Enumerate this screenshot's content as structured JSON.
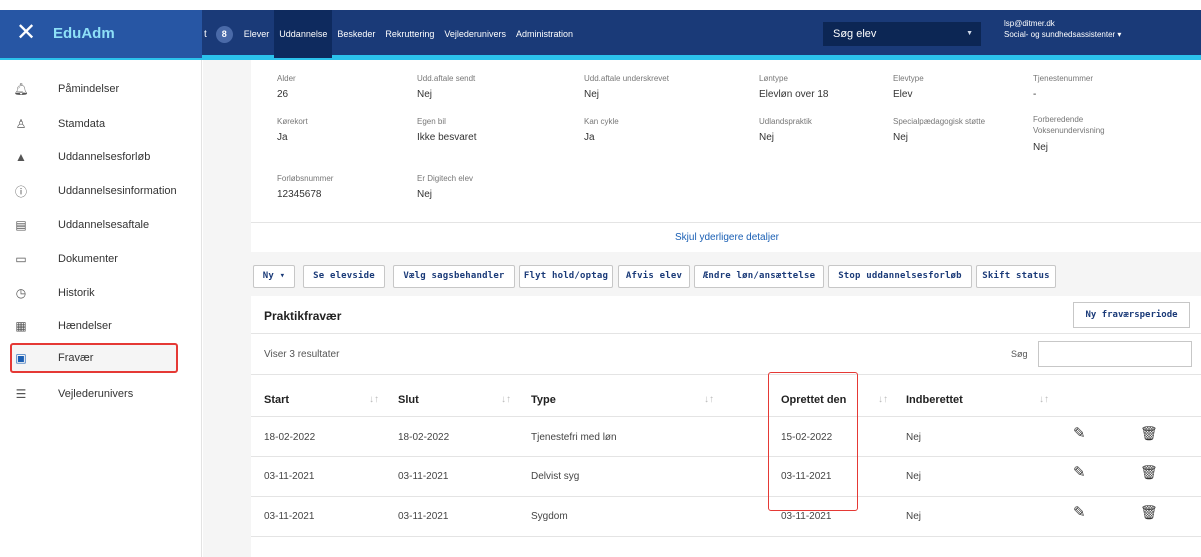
{
  "app": {
    "close_icon": "close-icon",
    "brand": "EduAdm"
  },
  "nav": {
    "cut_label": "t",
    "badge": "8",
    "items": [
      "Elever",
      "Uddannelse",
      "Beskeder",
      "Rekruttering",
      "Vejlederunivers",
      "Administration"
    ],
    "active": "Uddannelse"
  },
  "search": {
    "label": "Søg elev"
  },
  "user": {
    "email": "lsp@ditmer.dk",
    "title": "Social- og sundhedsassistenter"
  },
  "sidebar": {
    "items": [
      {
        "label": "Påmindelser",
        "icon": "bell-icon"
      },
      {
        "label": "Stamdata",
        "icon": "person-icon"
      },
      {
        "label": "Uddannelsesforløb",
        "icon": "graduation-cap-icon"
      },
      {
        "label": "Uddannelsesinformation",
        "icon": "info-icon"
      },
      {
        "label": "Uddannelsesaftale",
        "icon": "contract-icon"
      },
      {
        "label": "Dokumenter",
        "icon": "document-icon"
      },
      {
        "label": "Historik",
        "icon": "clock-icon"
      },
      {
        "label": "Hændelser",
        "icon": "calendar-icon"
      },
      {
        "label": "Fravær",
        "icon": "chart-icon"
      },
      {
        "label": "Vejlederunivers",
        "icon": "list-icon"
      }
    ],
    "active": "Fravær"
  },
  "details": {
    "row1": [
      {
        "k": "Alder",
        "v": "26"
      },
      {
        "k": "Udd.aftale sendt",
        "v": "Nej"
      },
      {
        "k": "Udd.aftale underskrevet",
        "v": "Nej"
      },
      {
        "k": "Løntype",
        "v": "Elevløn over 18"
      },
      {
        "k": "Elevtype",
        "v": "Elev"
      },
      {
        "k": "Tjenestenummer",
        "v": "-"
      }
    ],
    "row2": [
      {
        "k": "Kørekort",
        "v": "Ja"
      },
      {
        "k": "Egen bil",
        "v": "Ikke besvaret"
      },
      {
        "k": "Kan cykle",
        "v": "Ja"
      },
      {
        "k": "Udlandspraktik",
        "v": "Nej"
      },
      {
        "k": "Specialpædagogisk støtte",
        "v": "Nej"
      },
      {
        "k": "Forberedende Voksenundervisning",
        "v": "Nej"
      }
    ],
    "row3": [
      {
        "k": "Forløbsnummer",
        "v": "12345678"
      },
      {
        "k": "Er Digitech elev",
        "v": "Nej"
      }
    ],
    "hide_link": "Skjul yderligere detaljer"
  },
  "actions": [
    "Ny ▾",
    "Se elevside",
    "Vælg sagsbehandler",
    "Flyt hold/optag",
    "Afvis elev",
    "Ændre løn/ansættelse",
    "Stop uddannelsesforløb",
    "Skift status"
  ],
  "absence": {
    "title": "Praktikfravær",
    "new_button": "Ny fraværsperiode",
    "results": "Viser 3 resultater",
    "search_label": "Søg",
    "columns": [
      "Start",
      "Slut",
      "Type",
      "Oprettet den",
      "Indberettet"
    ],
    "rows": [
      {
        "start": "18-02-2022",
        "slut": "18-02-2022",
        "type": "Tjenestefri med løn",
        "oprettet": "15-02-2022",
        "indberettet": "Nej"
      },
      {
        "start": "03-11-2021",
        "slut": "03-11-2021",
        "type": "Delvist syg",
        "oprettet": "03-11-2021",
        "indberettet": "Nej"
      },
      {
        "start": "03-11-2021",
        "slut": "03-11-2021",
        "type": "Sygdom",
        "oprettet": "03-11-2021",
        "indberettet": "Nej"
      }
    ]
  },
  "colors": {
    "topbar": "#1a3a78",
    "brand_bg": "#2756a4",
    "accent": "#2bc2ec",
    "highlight": "#e53935"
  }
}
